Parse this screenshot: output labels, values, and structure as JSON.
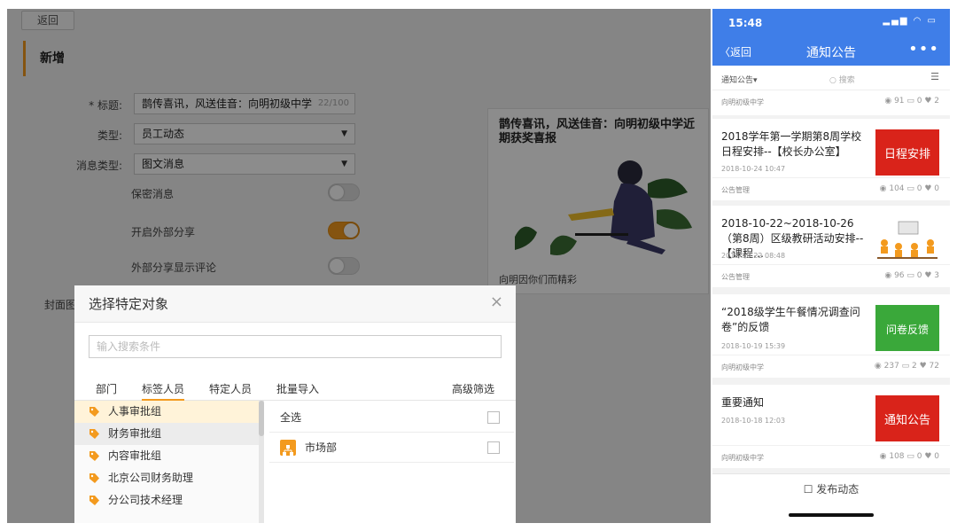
{
  "admin": {
    "back_label": "返回",
    "section_title": "新增",
    "form": {
      "title_label": "* 标题:",
      "title_value": "鹊传喜讯，风送佳音：向明初级中学",
      "title_count": "22/100",
      "type_label": "类型:",
      "type_value": "员工动态",
      "msg_type_label": "消息类型:",
      "msg_type_value": "图文消息",
      "toggle_confidential": "保密消息",
      "toggle_share": "开启外部分享",
      "toggle_comments": "外部分享显示评论",
      "cover_label": "封面图"
    },
    "preview": {
      "title": "鹊传喜讯，风送佳音：向明初级中学近期获奖喜报",
      "caption": "向明因你们而精彩"
    }
  },
  "modal": {
    "title": "选择特定对象",
    "close_glyph": "×",
    "search_placeholder": "输入搜索条件",
    "tabs": [
      "部门",
      "标签人员",
      "特定人员",
      "批量导入"
    ],
    "advanced_filter": "高级筛选",
    "groups": [
      "人事审批组",
      "财务审批组",
      "内容审批组",
      "北京公司财务助理",
      "分公司技术经理"
    ],
    "select_all": "全选",
    "departments": [
      "市场部"
    ]
  },
  "phone": {
    "time": "15:48",
    "back_label": "返回",
    "nav_title": "通知公告",
    "more_glyph": "•••",
    "filter_category": "通知公告▾",
    "filter_search": "○ 搜索",
    "top_source": "向明初级中学",
    "top_stats": "◉ 91 ▭ 0 ♥ 2",
    "cards": [
      {
        "title": "2018学年第一学期第8周学校日程安排--【校长办公室】",
        "date": "2018-10-24 10:47",
        "source": "公告管理",
        "stats": "◉ 104 ▭ 0 ♥ 0",
        "thumb_text": "日程安排",
        "thumb_color": "#d9231a"
      },
      {
        "title": "2018-10-22~2018-10-26（第8周）区级教研活动安排--【课程…",
        "date": "2018-10-22 08:48",
        "source": "公告管理",
        "stats": "◉ 96 ▭ 0 ♥ 3",
        "thumb_text": "",
        "thumb_color": "#ffffff"
      },
      {
        "title": "“2018级学生午餐情况调查问卷”的反馈",
        "date": "2018-10-19 15:39",
        "source": "向明初级中学",
        "stats": "◉ 237 ▭ 2 ♥ 72",
        "thumb_text": "问卷反馈",
        "thumb_color": "#3aa83a"
      },
      {
        "title": "重要通知",
        "date": "2018-10-18 12:03",
        "source": "向明初级中学",
        "stats": "◉ 108 ▭ 0 ♥ 0",
        "thumb_text": "通知公告",
        "thumb_color": "#d9231a"
      }
    ],
    "publish_label": "☐ 发布动态"
  },
  "colors": {
    "accent": "#f39a1e",
    "phone_blue": "#3f7ee8"
  }
}
